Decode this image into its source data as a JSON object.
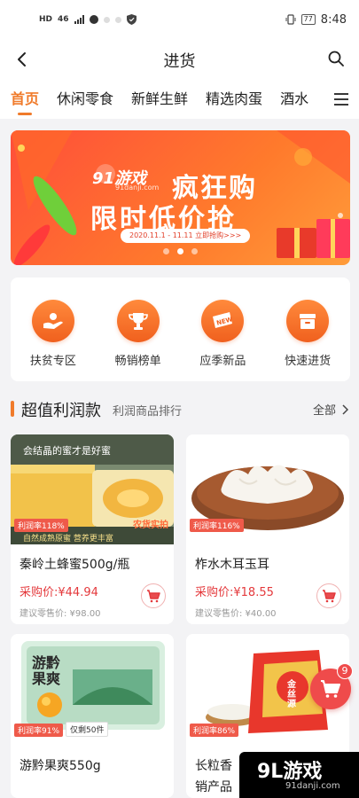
{
  "status_bar": {
    "network": "HD",
    "signal": "46",
    "battery": "77",
    "time": "8:48"
  },
  "navbar": {
    "title": "进货"
  },
  "tabs": [
    "首页",
    "休闲零食",
    "新鲜生鲜",
    "精选肉蛋",
    "酒水"
  ],
  "banner": {
    "logo": "91游戏",
    "logo_sub": "91danji.com",
    "headline_1": "疯狂购",
    "headline_2": "限时低价抢",
    "date_pill": "2020.11.1 - 11.11  立即抢购>>>",
    "slide_count": 3,
    "active_slide": 1
  },
  "categories": [
    {
      "label": "扶贫专区",
      "icon": "helping-hand-icon"
    },
    {
      "label": "畅销榜单",
      "icon": "trophy-icon"
    },
    {
      "label": "应季新品",
      "icon": "new-tag-icon"
    },
    {
      "label": "快速进货",
      "icon": "box-icon"
    }
  ],
  "section": {
    "title": "超值利润款",
    "subtitle": "利润商品排行",
    "all_label": "全部"
  },
  "products": [
    {
      "name": "秦岭土蜂蜜500g/瓶",
      "price_label": "采购价:",
      "price": "¥44.94",
      "retail": "建议零售价: ¥98.00",
      "profit_badge": "利润率118%",
      "image_text_top": "会结晶的蜜才是好蜜",
      "image_text_mid": "农货实拍",
      "image_text_bottom": "自然成熟原蜜 营养更丰富"
    },
    {
      "name": "柞水木耳玉耳",
      "price_label": "采购价:",
      "price": "¥18.55",
      "retail": "建议零售价: ¥40.00",
      "profit_badge": "利润率116%"
    },
    {
      "name": "游黔果爽550g",
      "profit_badge": "利润率91%",
      "stock_badge": "仅剩50件",
      "image_text": "游黔果爽"
    },
    {
      "name": "长粒香",
      "name_line2": "销产品",
      "profit_badge": "利润率86%",
      "image_text": "金丝源"
    }
  ],
  "floating_cart": {
    "count": "9"
  },
  "watermark": {
    "main": "9L游戏",
    "sub": "91danji.com"
  },
  "colors": {
    "accent": "#f07b2b",
    "price": "#e4393c",
    "badge": "#ef5a4a"
  }
}
